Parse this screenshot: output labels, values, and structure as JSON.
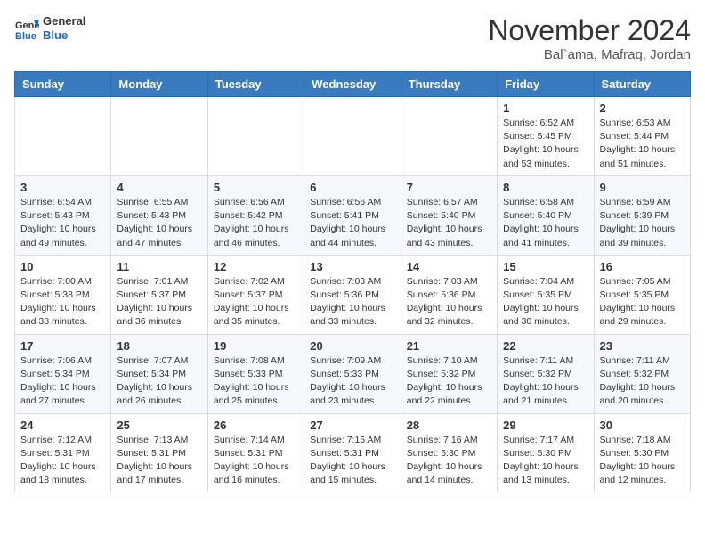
{
  "header": {
    "logo_general": "General",
    "logo_blue": "Blue",
    "month_title": "November 2024",
    "location": "Bal`ama, Mafraq, Jordan"
  },
  "weekdays": [
    "Sunday",
    "Monday",
    "Tuesday",
    "Wednesday",
    "Thursday",
    "Friday",
    "Saturday"
  ],
  "weeks": [
    [
      {
        "day": "",
        "info": ""
      },
      {
        "day": "",
        "info": ""
      },
      {
        "day": "",
        "info": ""
      },
      {
        "day": "",
        "info": ""
      },
      {
        "day": "",
        "info": ""
      },
      {
        "day": "1",
        "info": "Sunrise: 6:52 AM\nSunset: 5:45 PM\nDaylight: 10 hours\nand 53 minutes."
      },
      {
        "day": "2",
        "info": "Sunrise: 6:53 AM\nSunset: 5:44 PM\nDaylight: 10 hours\nand 51 minutes."
      }
    ],
    [
      {
        "day": "3",
        "info": "Sunrise: 6:54 AM\nSunset: 5:43 PM\nDaylight: 10 hours\nand 49 minutes."
      },
      {
        "day": "4",
        "info": "Sunrise: 6:55 AM\nSunset: 5:43 PM\nDaylight: 10 hours\nand 47 minutes."
      },
      {
        "day": "5",
        "info": "Sunrise: 6:56 AM\nSunset: 5:42 PM\nDaylight: 10 hours\nand 46 minutes."
      },
      {
        "day": "6",
        "info": "Sunrise: 6:56 AM\nSunset: 5:41 PM\nDaylight: 10 hours\nand 44 minutes."
      },
      {
        "day": "7",
        "info": "Sunrise: 6:57 AM\nSunset: 5:40 PM\nDaylight: 10 hours\nand 43 minutes."
      },
      {
        "day": "8",
        "info": "Sunrise: 6:58 AM\nSunset: 5:40 PM\nDaylight: 10 hours\nand 41 minutes."
      },
      {
        "day": "9",
        "info": "Sunrise: 6:59 AM\nSunset: 5:39 PM\nDaylight: 10 hours\nand 39 minutes."
      }
    ],
    [
      {
        "day": "10",
        "info": "Sunrise: 7:00 AM\nSunset: 5:38 PM\nDaylight: 10 hours\nand 38 minutes."
      },
      {
        "day": "11",
        "info": "Sunrise: 7:01 AM\nSunset: 5:37 PM\nDaylight: 10 hours\nand 36 minutes."
      },
      {
        "day": "12",
        "info": "Sunrise: 7:02 AM\nSunset: 5:37 PM\nDaylight: 10 hours\nand 35 minutes."
      },
      {
        "day": "13",
        "info": "Sunrise: 7:03 AM\nSunset: 5:36 PM\nDaylight: 10 hours\nand 33 minutes."
      },
      {
        "day": "14",
        "info": "Sunrise: 7:03 AM\nSunset: 5:36 PM\nDaylight: 10 hours\nand 32 minutes."
      },
      {
        "day": "15",
        "info": "Sunrise: 7:04 AM\nSunset: 5:35 PM\nDaylight: 10 hours\nand 30 minutes."
      },
      {
        "day": "16",
        "info": "Sunrise: 7:05 AM\nSunset: 5:35 PM\nDaylight: 10 hours\nand 29 minutes."
      }
    ],
    [
      {
        "day": "17",
        "info": "Sunrise: 7:06 AM\nSunset: 5:34 PM\nDaylight: 10 hours\nand 27 minutes."
      },
      {
        "day": "18",
        "info": "Sunrise: 7:07 AM\nSunset: 5:34 PM\nDaylight: 10 hours\nand 26 minutes."
      },
      {
        "day": "19",
        "info": "Sunrise: 7:08 AM\nSunset: 5:33 PM\nDaylight: 10 hours\nand 25 minutes."
      },
      {
        "day": "20",
        "info": "Sunrise: 7:09 AM\nSunset: 5:33 PM\nDaylight: 10 hours\nand 23 minutes."
      },
      {
        "day": "21",
        "info": "Sunrise: 7:10 AM\nSunset: 5:32 PM\nDaylight: 10 hours\nand 22 minutes."
      },
      {
        "day": "22",
        "info": "Sunrise: 7:11 AM\nSunset: 5:32 PM\nDaylight: 10 hours\nand 21 minutes."
      },
      {
        "day": "23",
        "info": "Sunrise: 7:11 AM\nSunset: 5:32 PM\nDaylight: 10 hours\nand 20 minutes."
      }
    ],
    [
      {
        "day": "24",
        "info": "Sunrise: 7:12 AM\nSunset: 5:31 PM\nDaylight: 10 hours\nand 18 minutes."
      },
      {
        "day": "25",
        "info": "Sunrise: 7:13 AM\nSunset: 5:31 PM\nDaylight: 10 hours\nand 17 minutes."
      },
      {
        "day": "26",
        "info": "Sunrise: 7:14 AM\nSunset: 5:31 PM\nDaylight: 10 hours\nand 16 minutes."
      },
      {
        "day": "27",
        "info": "Sunrise: 7:15 AM\nSunset: 5:31 PM\nDaylight: 10 hours\nand 15 minutes."
      },
      {
        "day": "28",
        "info": "Sunrise: 7:16 AM\nSunset: 5:30 PM\nDaylight: 10 hours\nand 14 minutes."
      },
      {
        "day": "29",
        "info": "Sunrise: 7:17 AM\nSunset: 5:30 PM\nDaylight: 10 hours\nand 13 minutes."
      },
      {
        "day": "30",
        "info": "Sunrise: 7:18 AM\nSunset: 5:30 PM\nDaylight: 10 hours\nand 12 minutes."
      }
    ]
  ]
}
